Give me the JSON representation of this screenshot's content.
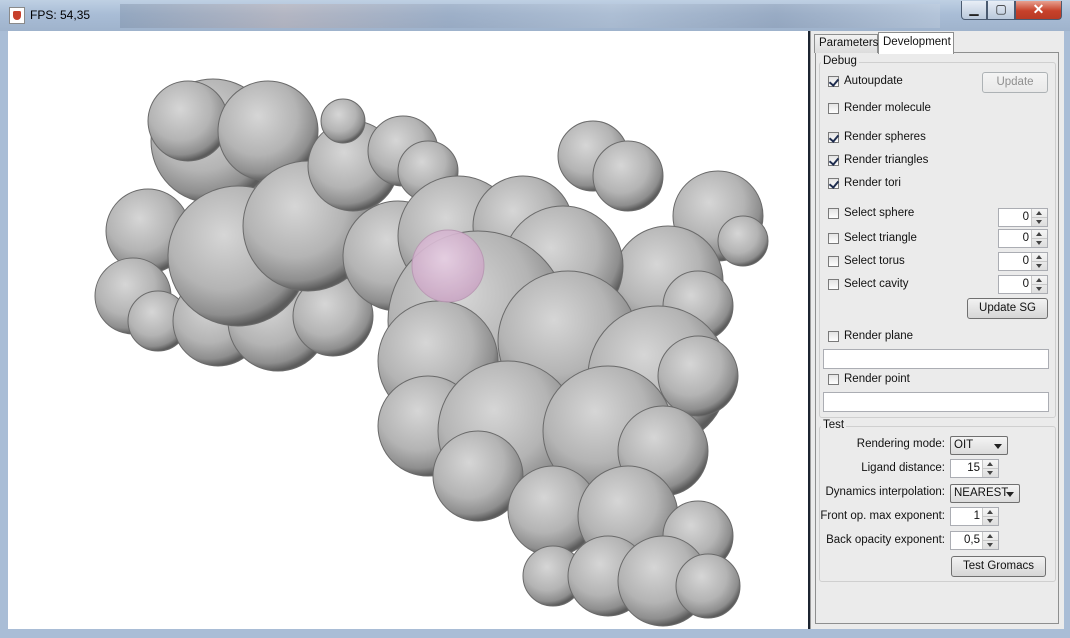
{
  "window": {
    "title": "FPS: 54,35",
    "icon": "java-cup-icon",
    "controls": {
      "minimize_icon": "minimize-icon",
      "maximize_icon": "maximize-icon",
      "close_icon": "close-icon"
    },
    "close_glyph": "✕",
    "minimize_glyph": "▁",
    "maximize_glyph": "▢"
  },
  "viewport": {
    "content": "molecule-surface",
    "highlight_color": "#d8b9d4"
  },
  "tabs": [
    {
      "label": "Parameters",
      "selected": false
    },
    {
      "label": "Development",
      "selected": true
    }
  ],
  "debug": {
    "group_label": "Debug",
    "autoupdate": {
      "label": "Autoupdate",
      "checked": true
    },
    "update_button": {
      "label": "Update",
      "enabled": false
    },
    "render_molecule": {
      "label": "Render molecule",
      "checked": false
    },
    "render_spheres": {
      "label": "Render spheres",
      "checked": true
    },
    "render_triangles": {
      "label": "Render triangles",
      "checked": true
    },
    "render_tori": {
      "label": "Render tori",
      "checked": true
    },
    "select_sphere": {
      "label": "Select sphere",
      "checked": false,
      "value": "0"
    },
    "select_triangle": {
      "label": "Select triangle",
      "checked": false,
      "value": "0"
    },
    "select_torus": {
      "label": "Select torus",
      "checked": false,
      "value": "0"
    },
    "select_cavity": {
      "label": "Select cavity",
      "checked": false,
      "value": "0"
    },
    "update_sg_button": {
      "label": "Update SG"
    },
    "render_plane": {
      "label": "Render plane",
      "checked": false,
      "value": ""
    },
    "render_point": {
      "label": "Render point",
      "checked": false,
      "value": ""
    }
  },
  "test": {
    "group_label": "Test",
    "rendering_mode": {
      "label": "Rendering mode:",
      "value": "OIT"
    },
    "ligand_distance": {
      "label": "Ligand distance:",
      "value": "15"
    },
    "dynamics_interpolation": {
      "label": "Dynamics interpolation:",
      "value": "NEAREST"
    },
    "front_op_max_exponent": {
      "label": "Front op. max exponent:",
      "value": "1"
    },
    "back_opacity_exponent": {
      "label": "Back opacity exponent:",
      "value": "0,5"
    },
    "test_gromacs_button": {
      "label": "Test Gromacs"
    }
  }
}
